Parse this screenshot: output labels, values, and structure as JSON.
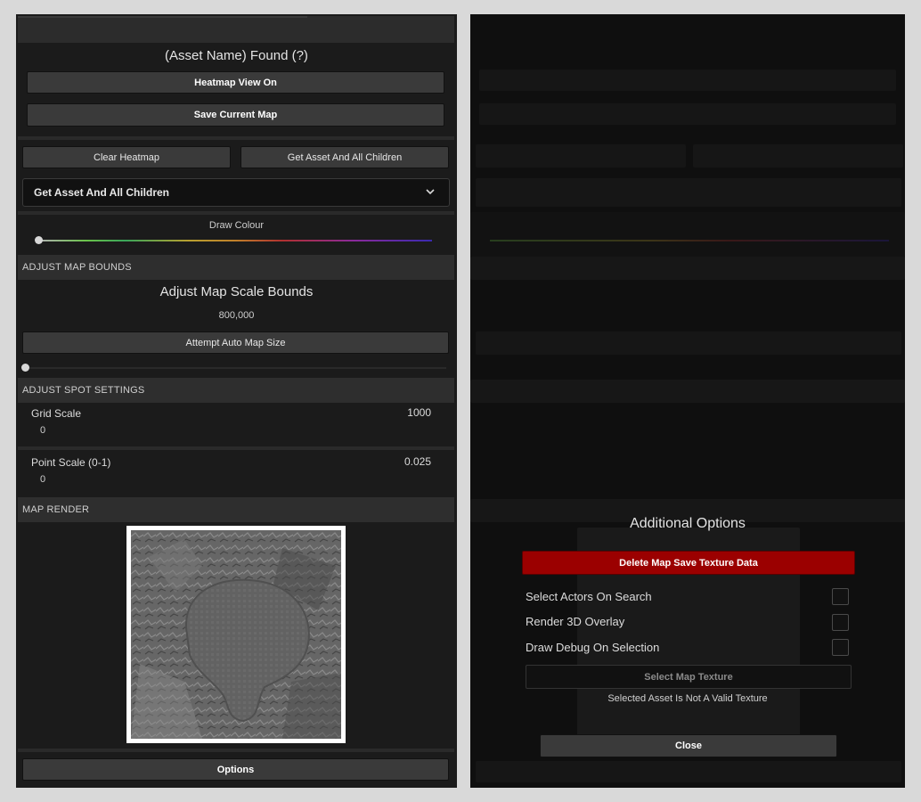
{
  "left": {
    "asset_title": "(Asset Name) Found (?)",
    "heatmap_btn": "Heatmap View On",
    "save_btn": "Save Current Map",
    "clear_btn": "Clear Heatmap",
    "get_children_btn": "Get Asset And All Children",
    "dropdown_value": "Get Asset And All Children",
    "draw_colour_label": "Draw Colour",
    "map_bounds_header": "ADJUST MAP BOUNDS",
    "map_scale_title": "Adjust Map Scale Bounds",
    "map_scale_value": "800,000",
    "auto_size_btn": "Attempt Auto Map Size",
    "spot_header": "ADJUST SPOT SETTINGS",
    "grid_scale_label": "Grid Scale",
    "grid_scale_max": "1000",
    "grid_scale_min": "0",
    "point_scale_label": "Point Scale (0-1)",
    "point_scale_max": "0.025",
    "point_scale_min": "0",
    "render_header": "MAP RENDER",
    "options_btn": "Options"
  },
  "modal": {
    "title": "Additional Options",
    "delete_btn": "Delete Map Save Texture Data",
    "opt1": "Select Actors On Search",
    "opt2": "Render 3D Overlay",
    "opt3": "Draw Debug On Selection",
    "select_texture_btn": "Select Map Texture",
    "status": "Selected Asset Is Not A Valid Texture",
    "close_btn": "Close"
  },
  "colors": {
    "danger": "#9b0000",
    "panel": "#1b1b1b",
    "button": "#3a3a3a"
  }
}
